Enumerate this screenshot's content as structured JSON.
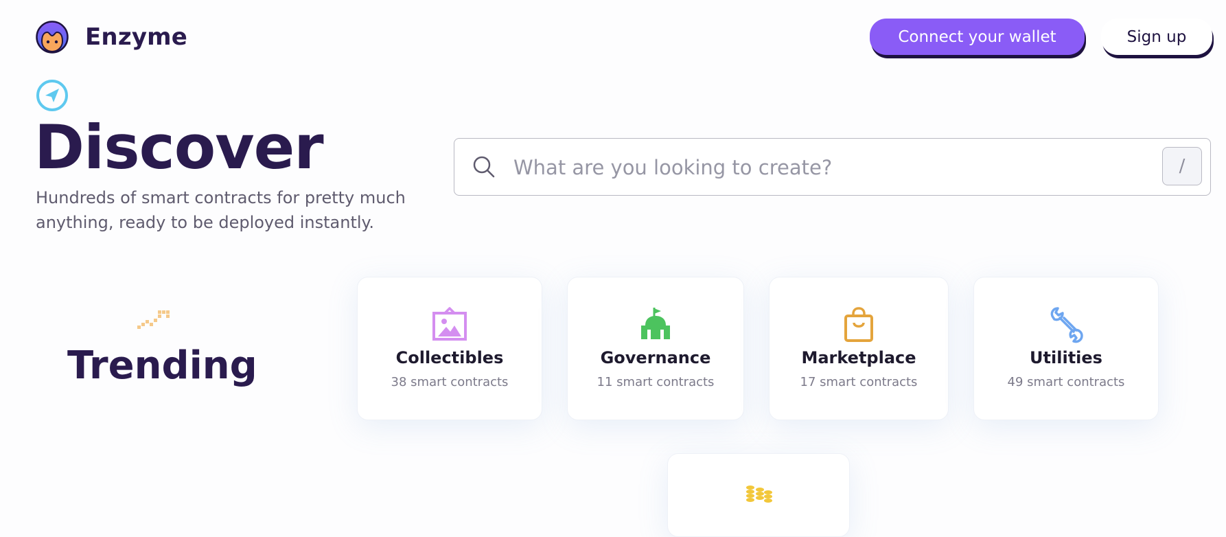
{
  "header": {
    "brand": "Enzyme",
    "connect_label": "Connect your wallet",
    "signup_label": "Sign up"
  },
  "hero": {
    "title": "Discover",
    "subtitle": "Hundreds of smart contracts for pretty much anything, ready to be deployed instantly."
  },
  "search": {
    "placeholder": "What are you looking to create?",
    "shortcut": "/"
  },
  "trending": {
    "title": "Trending",
    "cards": [
      {
        "name": "Collectibles",
        "count": "38 smart contracts",
        "icon": "picture-frame-icon"
      },
      {
        "name": "Governance",
        "count": "11 smart contracts",
        "icon": "capitol-building-icon"
      },
      {
        "name": "Marketplace",
        "count": "17 smart contracts",
        "icon": "shopping-bag-icon"
      },
      {
        "name": "Utilities",
        "count": "49 smart contracts",
        "icon": "wrench-icon"
      }
    ],
    "partial_card_icon": "coin-stacks-icon"
  },
  "colors": {
    "brand_purple": "#8a5cf6",
    "ink": "#2a1b4e",
    "compass_blue": "#5ec9ef",
    "collectibles": "#d48ef0",
    "governance": "#4cc35e",
    "marketplace": "#e4a43c",
    "utilities": "#6ea6f0",
    "coins": "#f2c73a"
  }
}
